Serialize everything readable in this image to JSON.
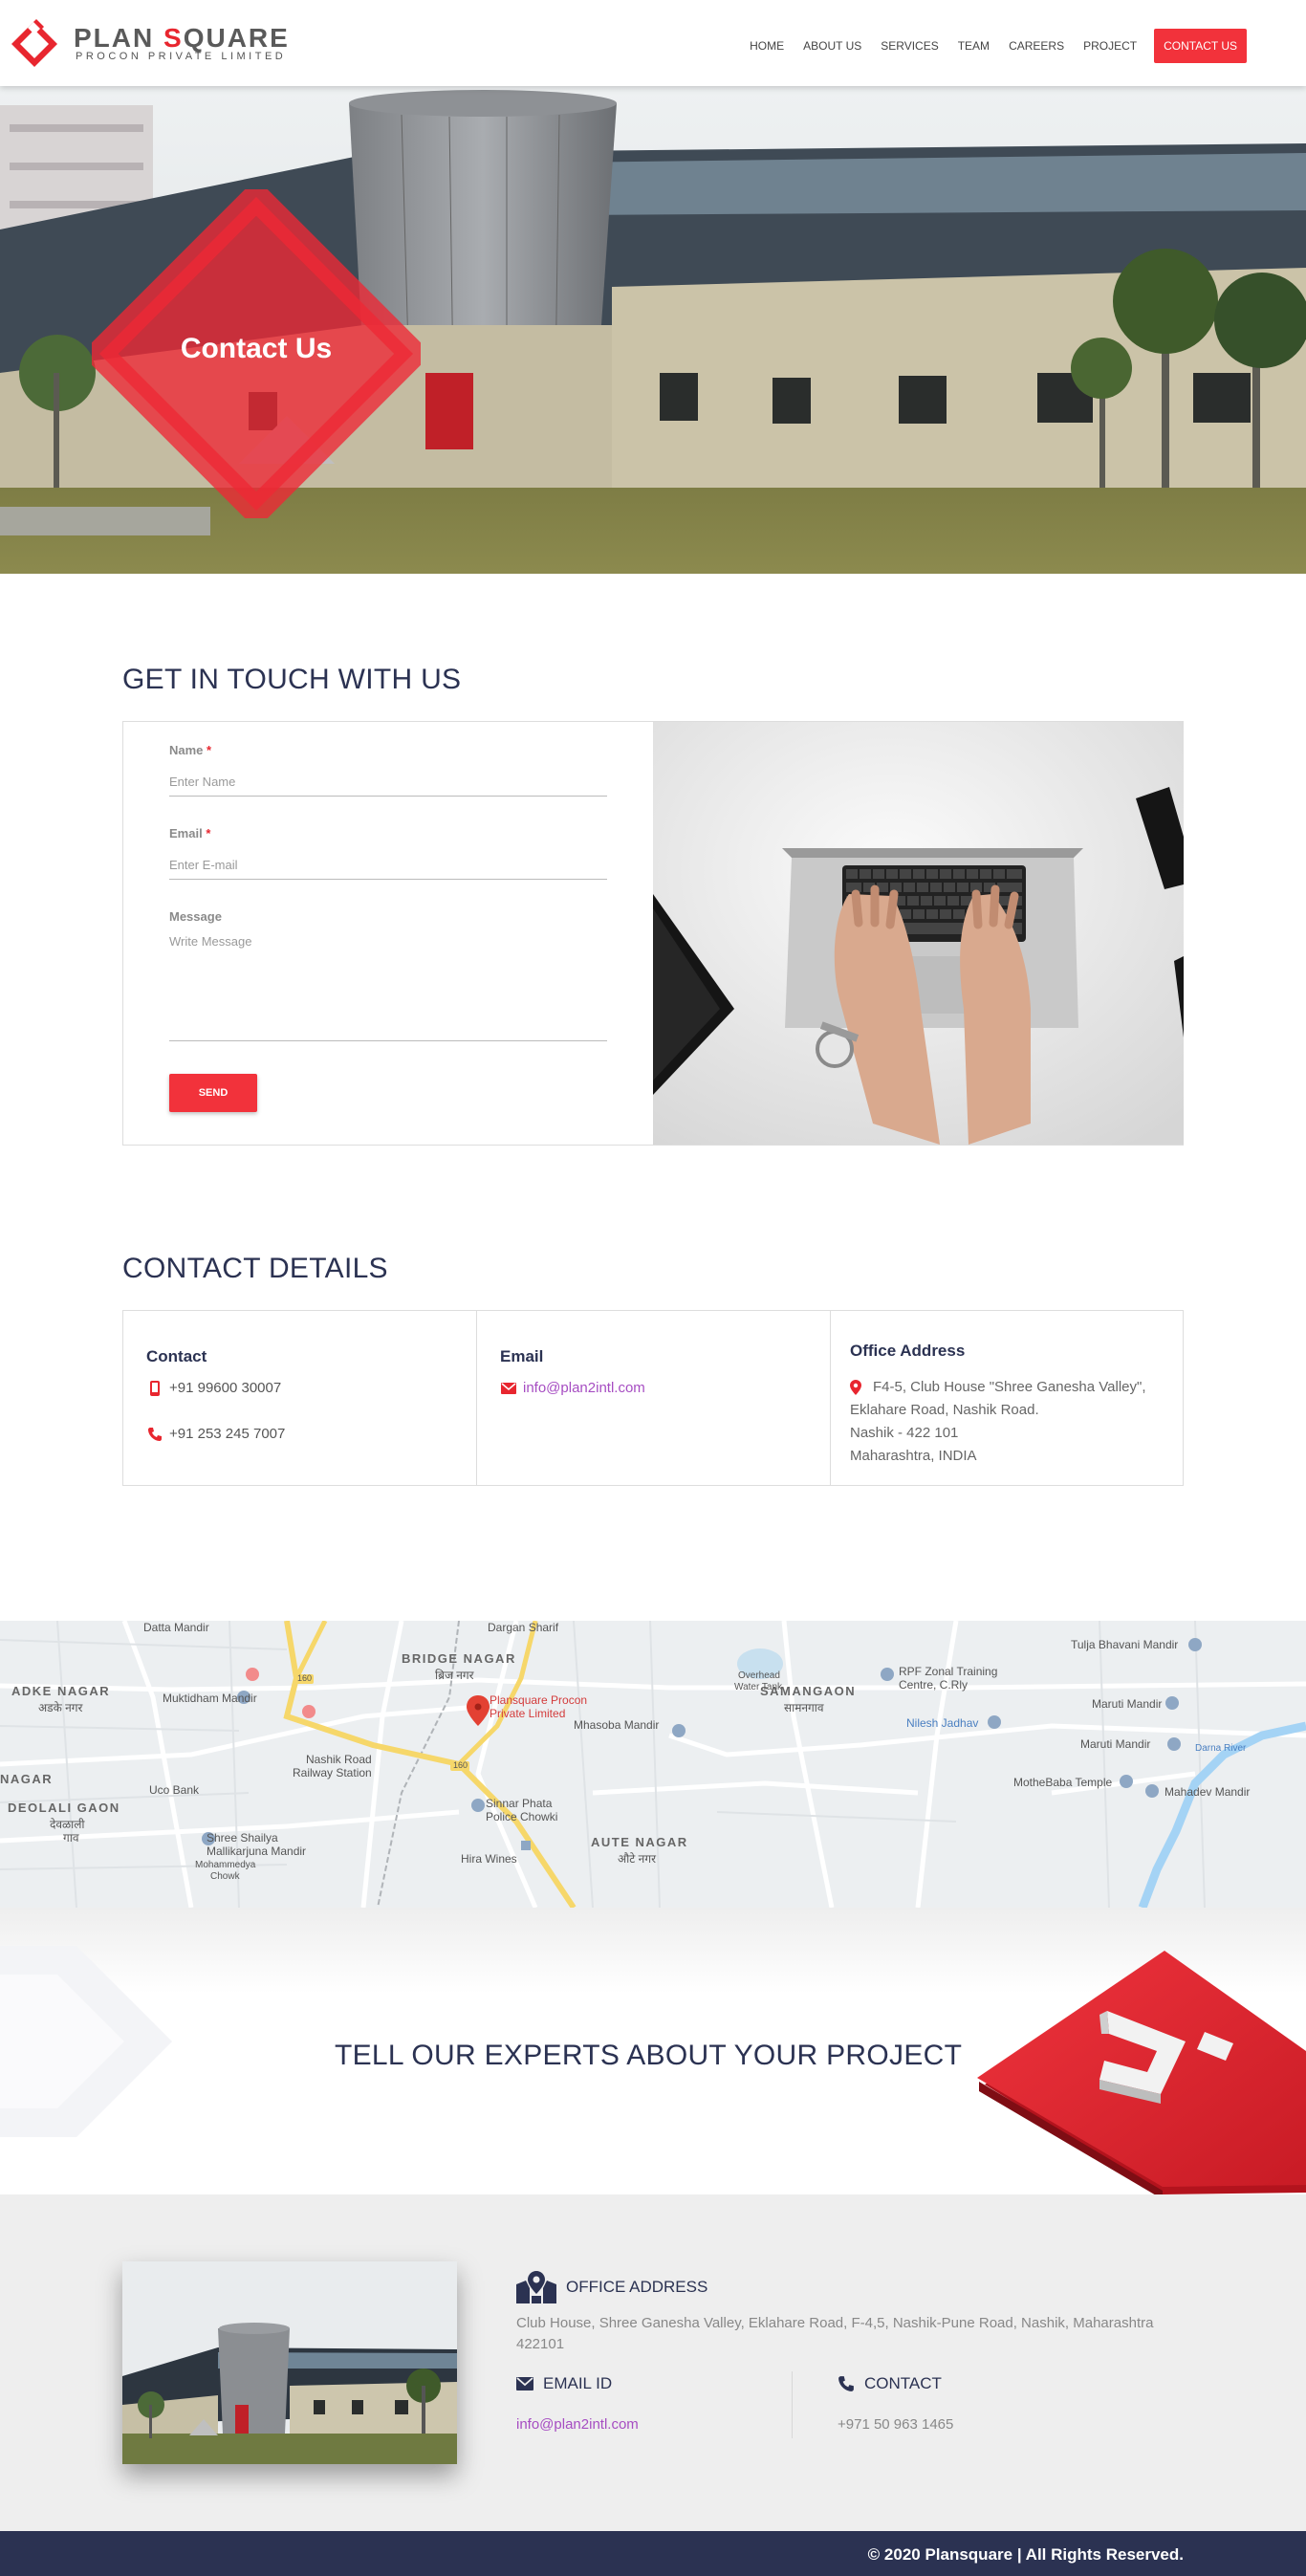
{
  "brand": {
    "name_part1": "PLAN ",
    "name_accent": "S",
    "name_part2": "QUARE",
    "subtitle": "PROCON PRIVATE LIMITED",
    "accent_color": "#e8262f",
    "navy_color": "#2b3252"
  },
  "nav": {
    "items": [
      "HOME",
      "ABOUT US",
      "SERVICES",
      "TEAM",
      "CAREERS",
      "PROJECT",
      "CONTACT US"
    ]
  },
  "hero": {
    "title": "Contact Us"
  },
  "get_in_touch": {
    "title": "GET IN TOUCH WITH US",
    "name_label": "Name",
    "name_placeholder": "Enter Name",
    "email_label": "Email",
    "email_placeholder": "Enter E-mail",
    "message_label": "Message",
    "message_placeholder": "Write Message",
    "required_mark": "*",
    "send_label": "SEND"
  },
  "contact_details": {
    "title": "CONTACT DETAILS",
    "contact_head": "Contact",
    "mobile": "+91 99600 30007",
    "phone": "+91 253 245 7007",
    "email_head": "Email",
    "email": "info@plan2intl.com",
    "office_head": "Office Address",
    "office_lines": [
      "F4-5, Club House \"Shree Ganesha Valley\",",
      "Eklahare Road, Nashik Road.",
      "Nashik - 422 101",
      "Maharashtra, INDIA"
    ]
  },
  "map": {
    "labels": {
      "datta_mandir": "Datta Mandir",
      "dargah": "Dargan Sharif",
      "bridge_nagar": "BRIDGE NAGAR",
      "bridge_nagar_hi": "ब्रिज नगर",
      "adke_nagar": "ADKE NAGAR",
      "adke_nagar_hi": "अडके नगर",
      "muktidham": "Muktidham Mandir",
      "samangaon": "SAMANGAON",
      "samangaon_hi": "सामनगाव",
      "rpf": "RPF Zonal Training",
      "rpf2": "Centre, C.Rly",
      "tulja": "Tulja Bhavani Mandir",
      "maruti1": "Maruti Mandir",
      "maruti2": "Maruti Mandir",
      "nilesh": "Nilesh Jadhav",
      "mhasoba": "Mhasoba Mandir",
      "plansquare1": "Plansquare Procon",
      "plansquare2": "Private Limited",
      "nagar": "NAGAR",
      "uco": "Uco Bank",
      "nashik_road": "Nashik Road",
      "railway_station": "Railway Station",
      "deolali": "DEOLALI GAON",
      "deolali_hi": "देवळाली",
      "gaon_hi": "गाव",
      "shree_shaila1": "Shree Shailya",
      "shree_shaila2": "Mallikarjuna Mandir",
      "mohammedya": "Mohammedya",
      "chowk": "Chowk",
      "sinnar1": "Sinnar Phata",
      "sinnar2": "Police Chowki",
      "hira": "Hira Wines",
      "aute": "AUTE NAGAR",
      "aute_hi": "औटे नगर",
      "mothebaba": "MotheBaba Temple",
      "mahadev": "Mahadev Mandir",
      "darna": "Darna River",
      "overhead1": "Overhead",
      "overhead2": "Water Tank",
      "road_160": "160"
    }
  },
  "cta": {
    "text": "TELL OUR EXPERTS ABOUT YOUR PROJECT"
  },
  "footer": {
    "office_head": "OFFICE ADDRESS",
    "office_text": "Club House, Shree Ganesha Valley, Eklahare Road, F-4,5, Nashik-Pune Road, Nashik, Maharashtra 422101",
    "email_head": "EMAIL ID",
    "email": "info@plan2intl.com",
    "contact_head": "CONTACT",
    "phone": "+971 50 963 1465",
    "copyright": "© 2020 Plansquare | All Rights Reserved."
  }
}
